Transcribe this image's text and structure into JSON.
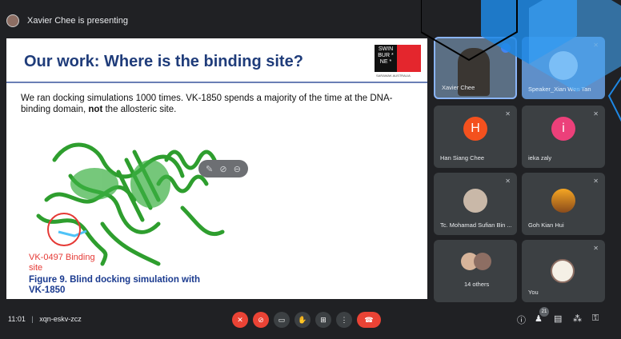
{
  "presenter": {
    "banner": "Xavier Chee is presenting"
  },
  "slide": {
    "title": "Our work: Where is the binding site?",
    "logo_text": "SWIN BUR * NE *",
    "logo_sub": "SARAWAK AUSTRALIA",
    "body_pre": "We ran docking simulations 1000 times. VK-1850 spends a majority of the time at the DNA-binding domain, ",
    "body_bold": "not",
    "body_post": " the allosteric site.",
    "site_label_1": "VK-0497 Binding",
    "site_label_2": "site",
    "caption_1": "Figure 9. Blind docking simulation with",
    "caption_2": "VK-1850"
  },
  "participants": [
    {
      "name": "Xavier Chee",
      "type": "video"
    },
    {
      "name": "Speaker_Xian Wen Tan",
      "type": "video"
    },
    {
      "name": "Han Siang Chee",
      "avatar_letter": "H",
      "avatar_color": "#f4511e"
    },
    {
      "name": "ieka zaly",
      "avatar_letter": "i",
      "avatar_color": "#ec407a"
    },
    {
      "name": "Tc. Mohamad Sufian Bin ...",
      "type": "photo"
    },
    {
      "name": "Goh Kian Hui",
      "type": "photo"
    },
    {
      "name": "14 others",
      "type": "group"
    },
    {
      "name": "You",
      "type": "photo"
    }
  ],
  "bottom": {
    "time": "11:01",
    "separator": "|",
    "meeting_code": "xqn-eskv-zcz",
    "people_count": "21"
  },
  "colors": {
    "accent_red": "#ea4335",
    "slide_title": "#1f3c7a",
    "caption": "#1a3a8f"
  }
}
